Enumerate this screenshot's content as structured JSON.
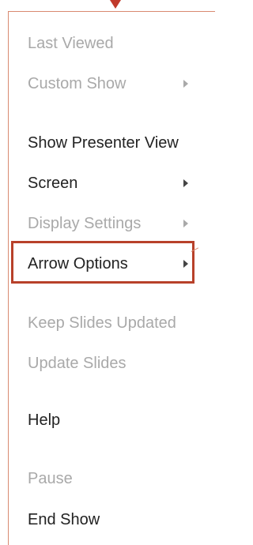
{
  "menu": {
    "items": [
      {
        "label": "Last Viewed",
        "disabled": true,
        "submenu": false
      },
      {
        "label": "Custom Show",
        "disabled": true,
        "submenu": true
      },
      {
        "label": "Show Presenter View",
        "disabled": false,
        "submenu": false
      },
      {
        "label": "Screen",
        "disabled": false,
        "submenu": true
      },
      {
        "label": "Display Settings",
        "disabled": true,
        "submenu": true
      },
      {
        "label": "Arrow Options",
        "disabled": false,
        "submenu": true,
        "highlighted": true
      },
      {
        "label": "Keep Slides Updated",
        "disabled": true,
        "submenu": false
      },
      {
        "label": "Update Slides",
        "disabled": true,
        "submenu": false
      },
      {
        "label": "Help",
        "disabled": false,
        "submenu": false
      },
      {
        "label": "Pause",
        "disabled": true,
        "submenu": false
      },
      {
        "label": "End Show",
        "disabled": false,
        "submenu": false
      }
    ]
  },
  "colors": {
    "enabled_text": "#222222",
    "disabled_text": "#a9a9a9",
    "highlight_border": "#b8412a",
    "accent": "#c0392b"
  }
}
